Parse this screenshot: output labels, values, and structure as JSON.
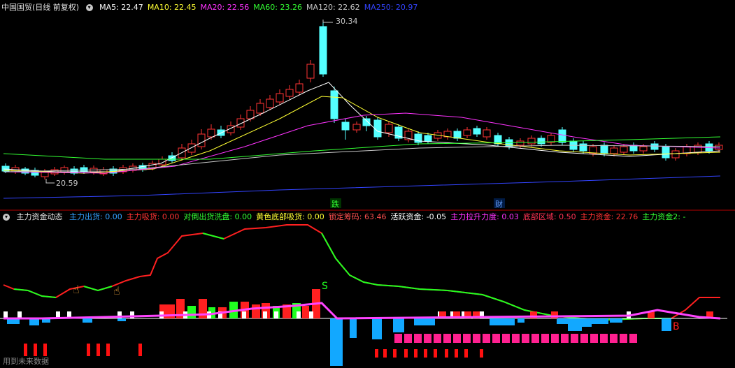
{
  "top": {
    "title": "中国国贸(日线 前复权)",
    "ma": [
      {
        "label": "MA5: 22.47",
        "color": "#ffffff"
      },
      {
        "label": "MA10: 22.45",
        "color": "#ffff33"
      },
      {
        "label": "MA20: 22.56",
        "color": "#ff33ff"
      },
      {
        "label": "MA60: 23.26",
        "color": "#33ff33"
      },
      {
        "label": "MA120: 22.62",
        "color": "#c8c8c8"
      },
      {
        "label": "MA250: 20.97",
        "color": "#3344ff"
      }
    ],
    "high_label": "30.34",
    "low_label": "20.59",
    "marker_die": "跌",
    "marker_cai": "财"
  },
  "bottom": {
    "indicator": "主力资金动态",
    "items": [
      {
        "label": "主力出货: 0.00",
        "color": "#33a0ff"
      },
      {
        "label": "主力吸货: 0.00",
        "color": "#ff3333"
      },
      {
        "label": "对倒出货洗盘: 0.00",
        "color": "#33ff33"
      },
      {
        "label": "黄色底部吸货: 0.00",
        "color": "#ffff33"
      },
      {
        "label": "锁定筹码: 63.46",
        "color": "#ff5050"
      },
      {
        "label": "活跃资金: -0.05",
        "color": "#ffffff"
      },
      {
        "label": "主力拉升力度: 0.03",
        "color": "#ff33ff"
      },
      {
        "label": "底部区域: 0.50",
        "color": "#ff3355"
      },
      {
        "label": "主力资金: 22.76",
        "color": "#ff3333"
      },
      {
        "label": "主力资金2: -",
        "color": "#33ff33"
      }
    ],
    "s_label": "S",
    "b_label": "B"
  },
  "watermark": "用到未来数据",
  "colors": {
    "up": "#ff3333",
    "down": "#54ffff",
    "bg": "#000000"
  }
}
